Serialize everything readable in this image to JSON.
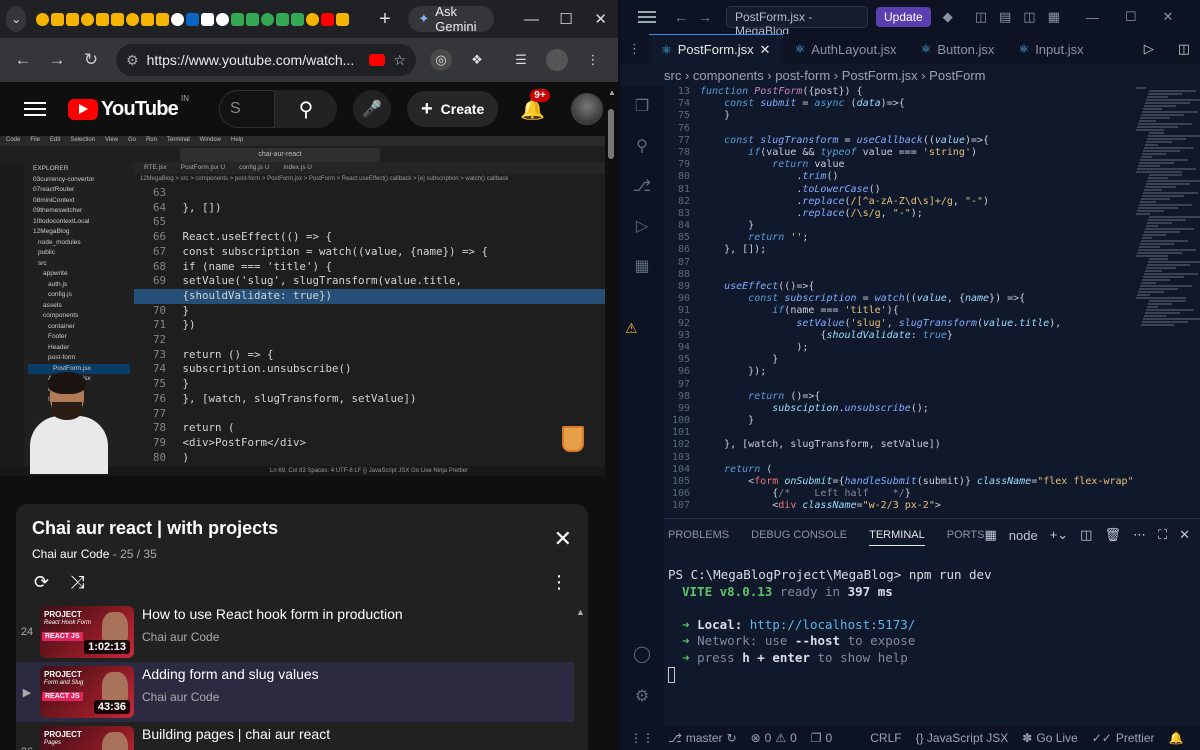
{
  "chrome": {
    "tab_search_icon": "chevron-down-icon",
    "new_tab": "+",
    "gemini_label": "Ask Gemini",
    "url": "https://www.youtube.com/watch...",
    "mini_tab_colors": [
      "#f5b400",
      "#f5b400",
      "#f5b400",
      "#f5b400",
      "#f5b400",
      "#f5b400",
      "#f5b400",
      "#f5b400",
      "#f5b400",
      "#ffffff",
      "#0a66c2",
      "#ffffff",
      "#ffffff",
      "#34a853",
      "#34a853",
      "#34a853",
      "#34a853",
      "#34a853",
      "#f5b400",
      "#ff0000",
      "#f5b400"
    ]
  },
  "youtube": {
    "logo": "YouTube",
    "region": "IN",
    "search_placeholder": "S",
    "create_label": "Create",
    "notif_count": "9+"
  },
  "video": {
    "mac_menu": [
      "Code",
      "File",
      "Edit",
      "Selection",
      "View",
      "Go",
      "Run",
      "Terminal",
      "Window",
      "Help"
    ],
    "title": "chai-aur-react",
    "tabs": [
      "RTE.jsx",
      "PostForm.jsx U",
      "config.js U",
      "index.js U"
    ],
    "breadcrumb": "12MegaBlog > src > components > post-form > PostForm.jsx > PostForm > React.useEffect() callback > [e] subscription > watch() callback",
    "explorer": [
      "EXPLORER",
      "03currency-convertor",
      "07reactRouter",
      "08miniContext",
      "09themeswitcher",
      "10todocontextLocal",
      "12MegaBlog",
      "node_modules",
      "public",
      "src",
      "appwrite",
      "auth.js",
      "config.js",
      "assets",
      "components",
      "container",
      "Footer",
      "Header",
      "post-form",
      "PostForm.jsx",
      "AuthLayout.jsx",
      "Button.jsx",
      "Input.jsx"
    ],
    "code": [
      {
        "n": "63",
        "t": ""
      },
      {
        "n": "64",
        "t": "    }, [])"
      },
      {
        "n": "65",
        "t": ""
      },
      {
        "n": "66",
        "t": "    React.useEffect(() => {"
      },
      {
        "n": "67",
        "t": "        const subscription = watch((value, {name}) => {"
      },
      {
        "n": "68",
        "t": "            if (name === 'title') {"
      },
      {
        "n": "69",
        "t": "                setValue('slug', slugTransform(value.title,"
      },
      {
        "n": "",
        "t": "                {shouldValidate: true})"
      },
      {
        "n": "70",
        "t": "            }"
      },
      {
        "n": "71",
        "t": "        })"
      },
      {
        "n": "72",
        "t": ""
      },
      {
        "n": "73",
        "t": "        return () => {"
      },
      {
        "n": "74",
        "t": "            subscription.unsubscribe()"
      },
      {
        "n": "75",
        "t": "        }"
      },
      {
        "n": "76",
        "t": "    }, [watch, slugTransform, setValue])"
      },
      {
        "n": "77",
        "t": ""
      },
      {
        "n": "78",
        "t": "  return ("
      },
      {
        "n": "79",
        "t": "    <div>PostForm</div>"
      },
      {
        "n": "80",
        "t": "  )"
      }
    ],
    "status": "Ln 69, Col 83   Spaces: 4   UTF-8   LF   {} JavaScript JSX   Go Live   Ninja   Prettier"
  },
  "playlist": {
    "title": "Chai aur react | with projects",
    "channel": "Chai aur Code",
    "position": "- 25 / 35",
    "items": [
      {
        "index": "24",
        "title": "How to use React hook form in production",
        "channel": "Chai aur Code",
        "duration": "1:02:13",
        "thumb_sub": "React Hook Form",
        "thumb_num": "23"
      },
      {
        "index": "▶",
        "title": "Adding form and slug values",
        "channel": "Chai aur Code",
        "duration": "43:36",
        "thumb_sub": "Form and Slug",
        "thumb_num": "24"
      },
      {
        "index": "26",
        "title": "Building pages | chai aur react",
        "channel": "",
        "duration": "",
        "thumb_sub": "Pages",
        "thumb_num": ""
      }
    ],
    "thumb_project": "PROJECT",
    "thumb_react": "REACT JS"
  },
  "vscode": {
    "search": "PostForm.jsx - MegaBlog",
    "update_label": "Update",
    "tabs": [
      "PostForm.jsx",
      "AuthLayout.jsx",
      "Button.jsx",
      "Input.jsx"
    ],
    "breadcrumb": [
      "src",
      "components",
      "post-form",
      "PostForm.jsx",
      "PostForm"
    ],
    "code": [
      {
        "n": "13",
        "h": "<span class=\"kw\">function</span> <span class=\"fn\">PostForm</span>({post}) {"
      },
      {
        "n": "74",
        "h": "    <span class=\"kw\">const</span> <span class=\"fc\">submit</span> = <span class=\"kw\">async</span> (<span class=\"vr\">data</span>)=>{"
      },
      {
        "n": "75",
        "h": "    }"
      },
      {
        "n": "76",
        "h": ""
      },
      {
        "n": "77",
        "h": "    <span class=\"kw\">const</span> <span class=\"fc\">slugTransform</span> = <span class=\"fc\">useCallback</span>((<span class=\"vr\">value</span>)=>{"
      },
      {
        "n": "78",
        "h": "        <span class=\"kw\">if</span>(value && <span class=\"kw\">typeof</span> value === <span class=\"str\">'string'</span>)"
      },
      {
        "n": "79",
        "h": "            <span class=\"kw\">return</span> value"
      },
      {
        "n": "80",
        "h": "                .<span class=\"fc\">trim</span>()"
      },
      {
        "n": "81",
        "h": "                .<span class=\"fc\">toLowerCase</span>()"
      },
      {
        "n": "82",
        "h": "                .<span class=\"fc\">replace</span>(<span class=\"str\">/[^a-zA-Z\\d\\s]+/g</span>, <span class=\"str\">\"-\"</span>)"
      },
      {
        "n": "83",
        "h": "                .<span class=\"fc\">replace</span>(<span class=\"str\">/\\s/g</span>, <span class=\"str\">\"-\"</span>);"
      },
      {
        "n": "84",
        "h": "        }"
      },
      {
        "n": "85",
        "h": "        <span class=\"kw\">return</span> <span class=\"str\">''</span>;"
      },
      {
        "n": "86",
        "h": "    }, []);"
      },
      {
        "n": "87",
        "h": ""
      },
      {
        "n": "88",
        "h": ""
      },
      {
        "n": "89",
        "h": "    <span class=\"fc\">useEffect</span>(()=>{"
      },
      {
        "n": "90",
        "h": "        <span class=\"kw\">const</span> <span class=\"fc\">subscription</span> = <span class=\"fc\">watch</span>((<span class=\"vr\">value</span>, {<span class=\"vr\">name</span>}) =>{"
      },
      {
        "n": "91",
        "h": "            <span class=\"kw\">if</span>(name === <span class=\"str\">'title'</span>){"
      },
      {
        "n": "92",
        "h": "                <span class=\"fc\">setValue</span>(<span class=\"str\">'slug'</span>, <span class=\"fc\">slugTransform</span>(<span class=\"vr\">value.title</span>),"
      },
      {
        "n": "93",
        "h": "                    {<span class=\"vr\">shouldValidate</span>: <span class=\"kw\">true</span>}"
      },
      {
        "n": "94",
        "h": "                );"
      },
      {
        "n": "95",
        "h": "            }"
      },
      {
        "n": "96",
        "h": "        });"
      },
      {
        "n": "97",
        "h": ""
      },
      {
        "n": "98",
        "h": "        <span class=\"kw\">return</span> ()=>{"
      },
      {
        "n": "99",
        "h": "            <span class=\"vr\">subsciption</span>.<span class=\"fc\">unsubscribe</span>();"
      },
      {
        "n": "100",
        "h": "        }"
      },
      {
        "n": "101",
        "h": ""
      },
      {
        "n": "102",
        "h": "    }, [watch, slugTransform, setValue])"
      },
      {
        "n": "103",
        "h": ""
      },
      {
        "n": "104",
        "h": "    <span class=\"kw\">return</span> ("
      },
      {
        "n": "105",
        "h": "        <<span class=\"tg\">form</span> <span class=\"vr\">onSubmit</span>={<span class=\"fc\">handleSubmit</span>(submit)} <span class=\"vr\">className</span>=<span class=\"str\">\"flex flex-wrap\"</span>>"
      },
      {
        "n": "106",
        "h": "            {<span class=\"tgray\">/*    Left half    */</span>}"
      },
      {
        "n": "107",
        "h": "            <<span class=\"tg\">div</span> <span class=\"vr\">className</span>=<span class=\"str\">\"w-2/3 px-2\"</span>>"
      }
    ],
    "panel_tabs": [
      "PROBLEMS",
      "DEBUG CONSOLE",
      "TERMINAL",
      "PORTS"
    ],
    "terminal_name": "node",
    "terminal": {
      "prompt": "PS C:\\MegaBlogProject\\MegaBlog> ",
      "command": "npm run dev",
      "vite": "VITE v8.0.13",
      "ready": "ready in",
      "ready_ms": "397 ms",
      "local_label": "Local:",
      "local_url": "http://localhost:5173/",
      "network_label": "Network:",
      "network_text": "use",
      "network_flag": "--host",
      "network_rest": "to expose",
      "help_pre": "press",
      "help_key": "h + enter",
      "help_rest": "to show help"
    },
    "status": {
      "branch": "master",
      "errors": "0",
      "warnings": "0",
      "ports": "0",
      "crlf": "CRLF",
      "lang": "{} JavaScript JSX",
      "golive": "Go Live",
      "prettier": "Prettier"
    }
  }
}
